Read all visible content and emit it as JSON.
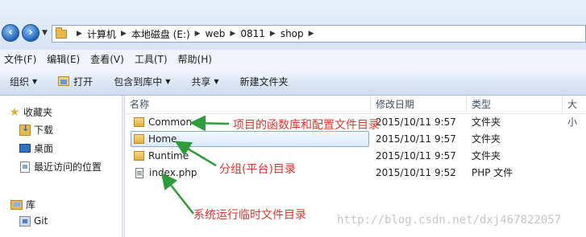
{
  "address_bar": {
    "back_icon": "back-arrow-icon",
    "forward_icon": "forward-arrow-icon",
    "breadcrumbs": [
      "计算机",
      "本地磁盘 (E:)",
      "web",
      "0811",
      "shop"
    ]
  },
  "menu": [
    "文件(F)",
    "编辑(E)",
    "查看(V)",
    "工具(T)",
    "帮助(H)"
  ],
  "toolbar": {
    "organize": "组织",
    "open": "打开",
    "include_in_library": "包含到库中",
    "share": "共享",
    "new_folder": "新建文件夹"
  },
  "nav_pane": {
    "favorites": "收藏夹",
    "downloads": "下载",
    "desktop": "桌面",
    "recent": "最近访问的位置",
    "libraries": "库",
    "git": "Git"
  },
  "columns": {
    "name": "名称",
    "modified": "修改日期",
    "type": "类型",
    "size": "大小"
  },
  "files": [
    {
      "name": "Common",
      "modified": "2015/10/11 9:57",
      "type": "文件夹",
      "icon": "folder-icon"
    },
    {
      "name": "Home",
      "modified": "2015/10/11 9:57",
      "type": "文件夹",
      "icon": "folder-icon",
      "selected": true
    },
    {
      "name": "Runtime",
      "modified": "2015/10/11 9:57",
      "type": "文件夹",
      "icon": "folder-icon"
    },
    {
      "name": "index.php",
      "modified": "2015/10/11 9:52",
      "type": "PHP 文件",
      "icon": "php-file-icon"
    }
  ],
  "annotations": {
    "common": "项目的函数库和配置文件目录",
    "home": "分组(平台)目录",
    "runtime": "系统运行临时文件目录",
    "color": "#e0342c"
  },
  "watermark": "http://blog.csdn.net/dxj467822057"
}
